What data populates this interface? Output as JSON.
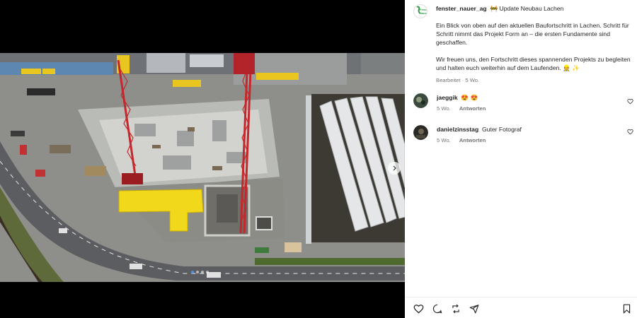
{
  "post": {
    "username": "fenster_nauer_ag",
    "title": "🚧 Update Neubau Lachen",
    "logo_text": "Fenst\nNaue",
    "caption_p1": "Ein Blick von oben auf den aktuellen Baufortschritt in Lachen. Schritt für Schritt nimmt das Projekt Form an – die ersten Fundamente sind geschaffen.",
    "caption_p2": "Wir freuen uns, den Fortschritt dieses spannenden Projekts zu begleiten und halten euch weiterhin auf dem Laufenden. 👷 ✨",
    "edited": "Bearbeitet · 5 Wo."
  },
  "comments": [
    {
      "user": "jaeggik",
      "text": "😍 😍",
      "time": "5 Wo.",
      "reply": "Antworten"
    },
    {
      "user": "danielzinsstag",
      "text": "Guter Fotograf",
      "time": "5 Wo.",
      "reply": "Antworten"
    }
  ],
  "media": {
    "image_count": 4,
    "active_index": 0
  },
  "icons": [
    "heart-icon",
    "comment-icon",
    "share-icon",
    "send-icon",
    "bookmark-icon",
    "chevron-right-icon"
  ],
  "colors": {
    "accent": "#0095f6",
    "construction_yellow": "#f2d81a",
    "crane_red": "#c4282c"
  }
}
